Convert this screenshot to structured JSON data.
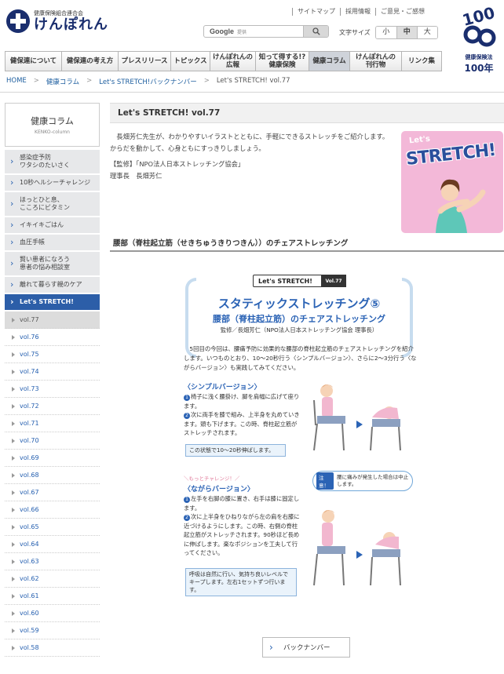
{
  "header": {
    "logo_sub": "健康保険組合連合会",
    "logo_main": "けんぽれん",
    "util_links": [
      "サイトマップ",
      "採用情報",
      "ご意見・ご感想"
    ],
    "search_label": "Google",
    "search_hint": "提供",
    "fontsize_label": "文字サイズ",
    "fontsize_options": [
      "小",
      "中",
      "大"
    ],
    "badge_caption": "健康保険法",
    "badge_number": "100年",
    "badge_art": "100"
  },
  "nav": {
    "items": [
      "健保連について",
      "健保連の考え方",
      "プレスリリース",
      "トピックス",
      "けんぽれんの\n広報",
      "知って得する!?\n健康保険",
      "健康コラム",
      "けんぽれんの\n刊行物",
      "リンク集"
    ]
  },
  "breadcrumb": [
    "HOME",
    "健康コラム",
    "Let's STRETCH!バックナンバー",
    "Let's STRETCH! vol.77"
  ],
  "sidebar": {
    "head_title": "健康コラム",
    "head_sub": "KENKO-column",
    "items": [
      {
        "label": "感染症予防\nワタシのたいさく"
      },
      {
        "label": "10秒ヘルシーチャレンジ"
      },
      {
        "label": "ほっとひと息、\nこころにビタミン"
      },
      {
        "label": "イキイキごはん"
      },
      {
        "label": "血圧手帳"
      },
      {
        "label": "賢い患者になろう\n患者の悩み相談室"
      },
      {
        "label": "離れて暮らす親のケア"
      },
      {
        "label": "Let's STRETCH!"
      }
    ],
    "vols": [
      "vol.77",
      "vol.76",
      "vol.75",
      "vol.74",
      "vol.73",
      "vol.72",
      "vol.71",
      "vol.70",
      "vol.69",
      "vol.68",
      "vol.67",
      "vol.66",
      "vol.65",
      "vol.64",
      "vol.63",
      "vol.62",
      "vol.61",
      "vol.60",
      "vol.59",
      "vol.58"
    ]
  },
  "main": {
    "title": "Let's STRETCH! vol.77",
    "intro": "長畑芳仁先生が、わかりやすいイラストとともに、手軽にできるストレッチをご紹介します。からだを動かして、心身ともにすっきりしましょう。",
    "supervisor": "【監修】「NPO法人日本ストレッチング協会」",
    "supervisor_name": "理事長　長畑芳仁",
    "hero_lets": "Let's",
    "hero_title": "STRETCH!",
    "section_title": "腰部（脊柱起立筋（せきちゅうきりつきん））のチェアストレッチング"
  },
  "article": {
    "pill": "Let's STRETCH!",
    "pill_vol": "Vol.77",
    "h1": "スタティックストレッチング⑤",
    "h2": "腰部（脊柱起立筋）のチェアストレッチング",
    "sup": "監修／長畑芳仁（NPO法人日本ストレッチング協会 理事長）",
    "lead": "5回目の今回は、腰痛予防に効果的な腰部の脊柱起立筋のチェアストレッチングを紹介します。いつものとおり、10～20秒行う〈シンプルバージョン〉、さらに2～3分行う〈ながらバージョン〉も実践してみてください。",
    "simple_title": "〈シンプルバージョン〉",
    "simple_steps": [
      "椅子に浅く腰掛け、脚を肩幅に広げて座ります。",
      "次に両手を膝で組み、上半身を丸めていきます。頭も下げます。この時、脊柱起立筋がストレッチされます。"
    ],
    "simple_note": "この状態で10～20秒伸ばします。",
    "challenge": "＼もっとチャレンジ！／",
    "nagara_title": "〈ながらバージョン〉",
    "nagara_steps": [
      "左手を右脚の膝に置き、右手は膝に固定します。",
      "次に上半身をひねりながら左の肩を右膝に近づけるようにします。この時、右側の脊柱起立筋がストレッチされます。90秒ほど長めに伸ばします。楽なポジションを工夫して行ってください。"
    ],
    "nagara_note": "呼吸は自然に行い、気持ち良いレベルでキープします。左右1セットずつ行います。",
    "warn_tag": "注意！",
    "warn_text": "腰に痛みが発生した場合は中止します。",
    "back_button": "バックナンバー"
  },
  "colors": {
    "brand": "#1a2e6e",
    "accent": "#2b63b5",
    "active_side": "#2c5ea8"
  }
}
